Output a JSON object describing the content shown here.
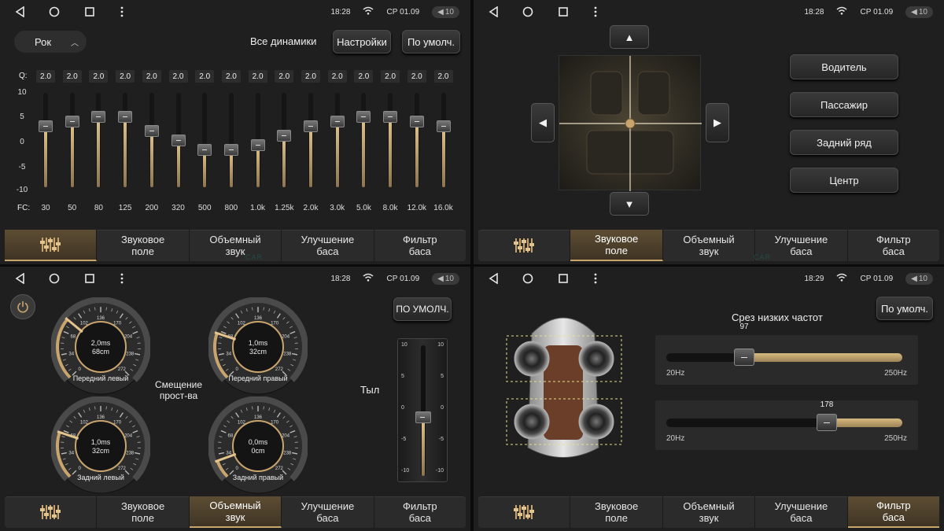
{
  "status": [
    {
      "time": "18:28",
      "date": "СР 01.09",
      "volume": "10"
    },
    {
      "time": "18:28",
      "date": "СР 01.09",
      "volume": "10"
    },
    {
      "time": "18:28",
      "date": "СР 01.09",
      "volume": "10"
    },
    {
      "time": "18:29",
      "date": "СР 01.09",
      "volume": "10"
    }
  ],
  "tabs": [
    "Звуковое\nполе",
    "Объемный\nзвук",
    "Улучшение\nбаса",
    "Фильтр\nбаса"
  ],
  "eq": {
    "preset": "Рок",
    "all_speakers": "Все динамики",
    "settings_label": "Настройки",
    "default_label": "По умолч.",
    "q_label": "Q:",
    "fc_label": "FC:",
    "scale": [
      "10",
      "5",
      "0",
      "-5",
      "-10"
    ],
    "bands": [
      {
        "fc": "30",
        "q": "2.0",
        "gain": 3
      },
      {
        "fc": "50",
        "q": "2.0",
        "gain": 4
      },
      {
        "fc": "80",
        "q": "2.0",
        "gain": 5
      },
      {
        "fc": "125",
        "q": "2.0",
        "gain": 5
      },
      {
        "fc": "200",
        "q": "2.0",
        "gain": 2
      },
      {
        "fc": "320",
        "q": "2.0",
        "gain": 0
      },
      {
        "fc": "500",
        "q": "2.0",
        "gain": -2
      },
      {
        "fc": "800",
        "q": "2.0",
        "gain": -2
      },
      {
        "fc": "1.0k",
        "q": "2.0",
        "gain": -1
      },
      {
        "fc": "1.25k",
        "q": "2.0",
        "gain": 1
      },
      {
        "fc": "2.0k",
        "q": "2.0",
        "gain": 3
      },
      {
        "fc": "3.0k",
        "q": "2.0",
        "gain": 4
      },
      {
        "fc": "5.0k",
        "q": "2.0",
        "gain": 5
      },
      {
        "fc": "8.0k",
        "q": "2.0",
        "gain": 5
      },
      {
        "fc": "12.0k",
        "q": "2.0",
        "gain": 4
      },
      {
        "fc": "16.0k",
        "q": "2.0",
        "gain": 3
      }
    ]
  },
  "position": {
    "up": "▲",
    "down": "▼",
    "left": "◀",
    "right": "▶",
    "buttons": [
      "Водитель",
      "Пассажир",
      "Задний ряд",
      "Центр"
    ]
  },
  "delay": {
    "default_label": "ПО УМОЛЧ.",
    "center_label": "Смещение\nпрост-ва",
    "rear_label": "Тыл",
    "dial_ticks": [
      "0",
      "34",
      "68",
      "102",
      "136",
      "170",
      "204",
      "238",
      "272"
    ],
    "dials": [
      {
        "name": "Передний левый",
        "value": "2,0ms\n68cm"
      },
      {
        "name": "Передний правый",
        "value": "1,0ms\n32cm"
      },
      {
        "name": "Задний левый",
        "value": "1,0ms\n32cm"
      },
      {
        "name": "Задний правый",
        "value": "0,0ms\n0cm"
      }
    ],
    "vslider_scale": [
      "10",
      "5",
      "0",
      "-5",
      "-10"
    ],
    "rear_value": -1
  },
  "crossover": {
    "default_label": "По умолч.",
    "title": "Срез низких частот",
    "sliders": [
      {
        "value": "97",
        "min": "20Hz",
        "max": "250Hz",
        "fraction": 0.33
      },
      {
        "value": "178",
        "min": "20Hz",
        "max": "250Hz",
        "fraction": 0.68
      }
    ]
  },
  "watermark": "CAR"
}
